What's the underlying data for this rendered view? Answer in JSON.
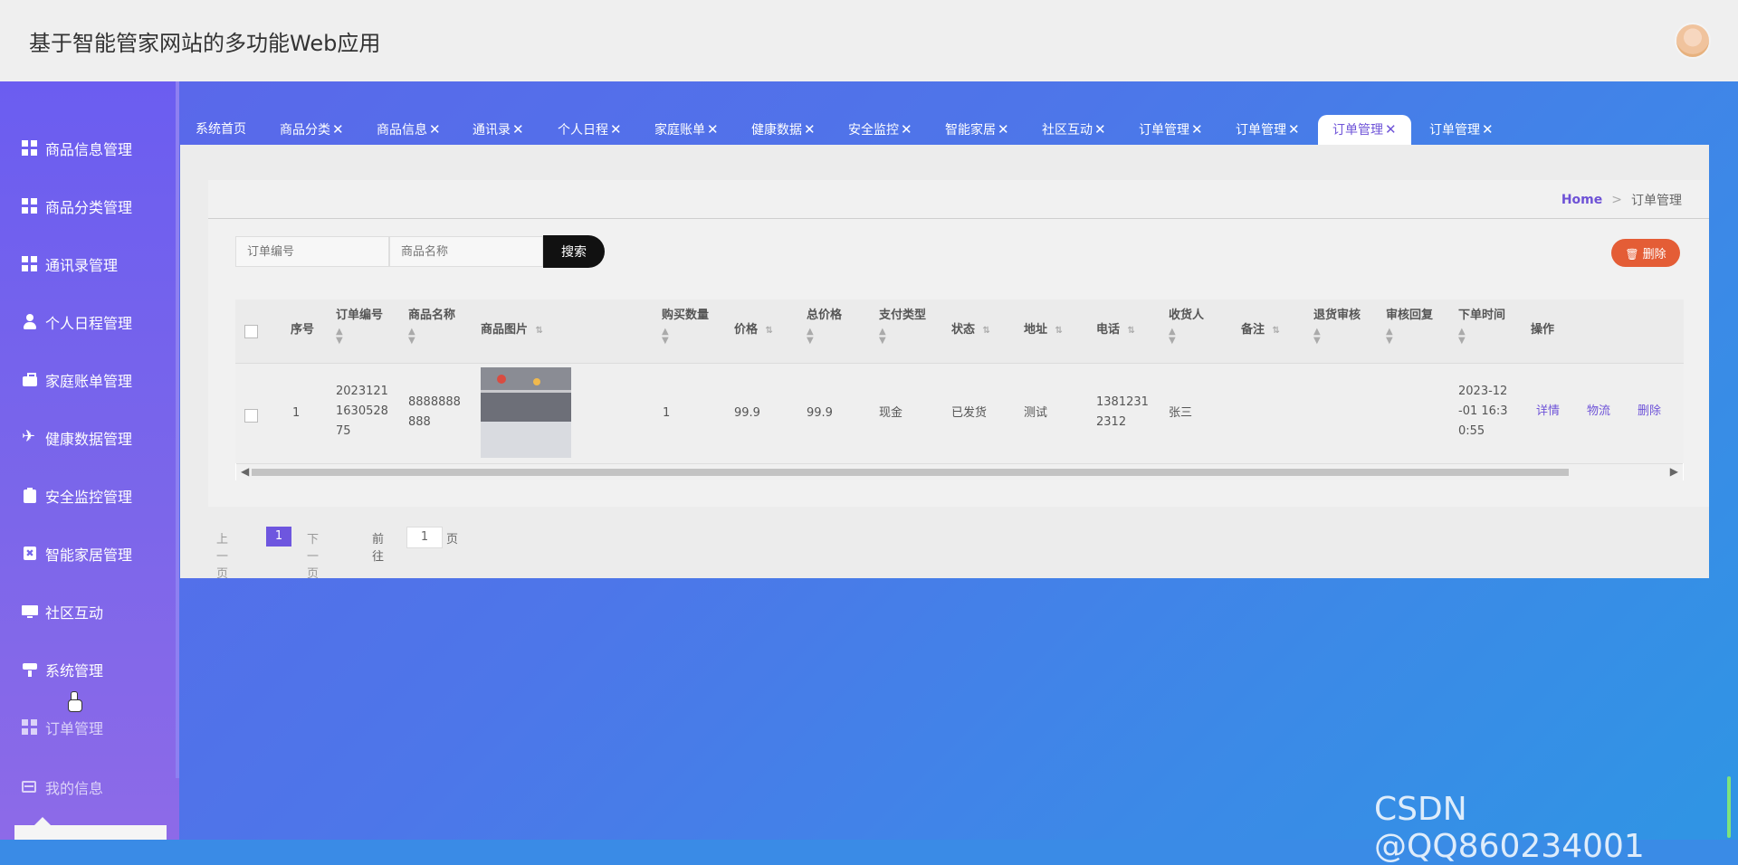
{
  "app": {
    "title": "基于智能管家网站的多功能Web应用"
  },
  "sidebar": {
    "items": [
      {
        "label": "商品信息管理",
        "icon": "grid-icon"
      },
      {
        "label": "商品分类管理",
        "icon": "grid-icon"
      },
      {
        "label": "通讯录管理",
        "icon": "grid-icon"
      },
      {
        "label": "个人日程管理",
        "icon": "user-icon"
      },
      {
        "label": "家庭账单管理",
        "icon": "briefcase-icon"
      },
      {
        "label": "健康数据管理",
        "icon": "paper-plane-icon"
      },
      {
        "label": "安全监控管理",
        "icon": "clipboard-icon"
      },
      {
        "label": "智能家居管理",
        "icon": "x-card-icon"
      },
      {
        "label": "社区互动",
        "icon": "monitor-icon"
      },
      {
        "label": "系统管理",
        "icon": "tool-icon"
      },
      {
        "label": "订单管理",
        "icon": "grid-icon"
      },
      {
        "label": "我的信息",
        "icon": "card-icon"
      }
    ]
  },
  "tabs": [
    {
      "label": "系统首页",
      "closable": false
    },
    {
      "label": "商品分类",
      "closable": true
    },
    {
      "label": "商品信息",
      "closable": true
    },
    {
      "label": "通讯录",
      "closable": true
    },
    {
      "label": "个人日程",
      "closable": true
    },
    {
      "label": "家庭账单",
      "closable": true
    },
    {
      "label": "健康数据",
      "closable": true
    },
    {
      "label": "安全监控",
      "closable": true
    },
    {
      "label": "智能家居",
      "closable": true
    },
    {
      "label": "社区互动",
      "closable": true
    },
    {
      "label": "订单管理",
      "closable": true
    },
    {
      "label": "订单管理",
      "closable": true
    },
    {
      "label": "订单管理",
      "closable": true,
      "active": true
    },
    {
      "label": "订单管理",
      "closable": true
    }
  ],
  "tab_close_symbol": "✕",
  "breadcrumb": {
    "home": "Home",
    "separator": ">",
    "current": "订单管理"
  },
  "search": {
    "order_placeholder": "订单编号",
    "product_placeholder": "商品名称",
    "button": "搜索"
  },
  "toolbar": {
    "delete_label": "删除"
  },
  "table": {
    "headers": [
      "序号",
      "订单编号",
      "商品名称",
      "商品图片",
      "购买数量",
      "价格",
      "总价格",
      "支付类型",
      "状态",
      "地址",
      "电话",
      "收货人",
      "备注",
      "退货审核",
      "审核回复",
      "下单时间",
      "操作"
    ],
    "rows": [
      {
        "index": "1",
        "order_no_lines": [
          "2023121",
          "1630528",
          "75"
        ],
        "product_name_lines": [
          "8888888",
          "888"
        ],
        "quantity": "1",
        "price": "99.9",
        "total": "99.9",
        "payment": "现金",
        "status": "已发货",
        "address": "测试",
        "phone_lines": [
          "1381231",
          "2312"
        ],
        "receiver": "张三",
        "remark": "",
        "return_review": "",
        "review_reply": "",
        "order_time_lines": [
          "2023-12",
          "-01 16:3",
          "0:55"
        ],
        "actions": [
          "详情",
          "物流",
          "删除"
        ]
      }
    ]
  },
  "pagination": {
    "prev": "上一页",
    "current": "1",
    "next": "下一页",
    "goto": "前往",
    "goto_value": "1",
    "unit": "页"
  },
  "watermark": "CSDN @QQ860234001",
  "colors": {
    "accent": "#6f54d8",
    "danger": "#e45d36",
    "sidebar": "#6b5df0"
  }
}
